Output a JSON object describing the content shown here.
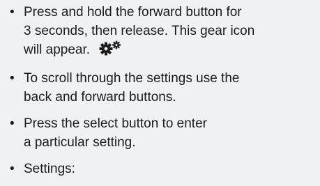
{
  "bullet_symbol": "•",
  "items": [
    {
      "line1": "Press and hold the forward button for",
      "line2": "3 seconds, then release. This gear icon",
      "line3": "will appear.",
      "icon": "gear-icon"
    },
    {
      "line1": "To scroll through the settings use the",
      "line2": "back and forward buttons."
    },
    {
      "line1": "Press the select button to enter",
      "line2": "a particular setting."
    },
    {
      "line1": "Settings:"
    }
  ]
}
